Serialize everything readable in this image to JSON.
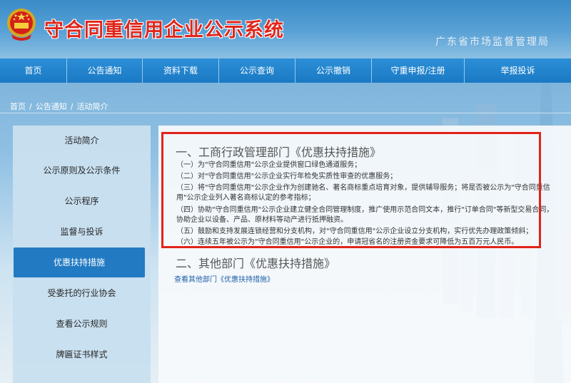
{
  "header": {
    "site_title": "守合同重信用企业公示系统",
    "agency": "广东省市场监督管理局"
  },
  "nav": {
    "items": [
      {
        "label": "首页"
      },
      {
        "label": "公告通知"
      },
      {
        "label": "资料下载"
      },
      {
        "label": "公示查询"
      },
      {
        "label": "公示撤销"
      },
      {
        "label": "守重申报/注册"
      },
      {
        "label": "举报投诉"
      }
    ]
  },
  "breadcrumb": {
    "home": "首页",
    "parent": "公告通知",
    "current": "活动简介",
    "separator": "/"
  },
  "sidebar": {
    "items": [
      {
        "label": "活动简介"
      },
      {
        "label": "公示原则及公示条件"
      },
      {
        "label": "公示程序"
      },
      {
        "label": "监督与投诉"
      },
      {
        "label": "优惠扶持措施"
      },
      {
        "label": "受委托的行业协会"
      },
      {
        "label": "查看公示规则"
      },
      {
        "label": "牌匾证书样式"
      }
    ],
    "active_index": 4
  },
  "main": {
    "section1_title": "一、工商行政管理部门《优惠扶持措施》",
    "section1_items": [
      "（一）为\"守合同重信用\"公示企业提供窗口绿色通道服务；",
      "（二）对\"守合同重信用\"公示企业实行年检免实质性审查的优惠服务；",
      "（三）将\"守合同重信用\"公示企业作为创建驰名、著名商标重点培育对象，提供辅导服务；将是否被公示为\"守合同重信",
      "用\"公示企业列入著名商标认定的参考指标；",
      "（四）协助\"守合同重信用\"公示企业建立健全合同管理制度，推广使用示范合同文本，推行\"订单合同\"等新型交易合同，",
      "协助企业以设备、产品、原材料等动产进行抵押融资。",
      "（五）鼓励和支持发展连锁经营和分支机构，对\"守合同重信用\"公示企业设立分支机构，实行优先办理政策倾斜；",
      "（六）连续五年被公示为\"守合同重信用\"公示企业的，申请冠省名的注册资金要求可降低为五百万元人民币。"
    ],
    "section2_title": "二、其他部门《优惠扶持措施》",
    "section2_link": "查看其他部门《优惠扶持措施》"
  },
  "colors": {
    "nav_bg": "#1b79c4",
    "title_red": "#e0261b",
    "highlight_border": "#e2231a",
    "active_sidebar": "#1d78c1"
  }
}
